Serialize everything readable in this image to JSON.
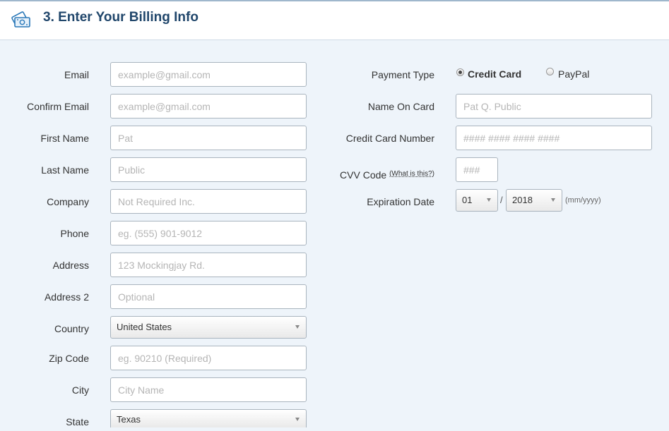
{
  "header": {
    "title": "3. Enter Your Billing Info",
    "icon": "money-icon",
    "accent": "#20466b"
  },
  "left_fields": {
    "email": {
      "label": "Email",
      "placeholder": "example@gmail.com"
    },
    "confirm_email": {
      "label": "Confirm Email",
      "placeholder": "example@gmail.com"
    },
    "first_name": {
      "label": "First Name",
      "placeholder": "Pat"
    },
    "last_name": {
      "label": "Last Name",
      "placeholder": "Public"
    },
    "company": {
      "label": "Company",
      "placeholder": "Not Required Inc."
    },
    "phone": {
      "label": "Phone",
      "placeholder": "eg. (555) 901-9012"
    },
    "address": {
      "label": "Address",
      "placeholder": "123 Mockingjay Rd."
    },
    "address2": {
      "label": "Address 2",
      "placeholder": "Optional"
    },
    "country": {
      "label": "Country",
      "value": "United States"
    },
    "zip": {
      "label": "Zip Code",
      "placeholder": "eg. 90210 (Required)"
    },
    "city": {
      "label": "City",
      "placeholder": "City Name"
    },
    "state": {
      "label": "State",
      "value": "Texas"
    }
  },
  "payment": {
    "type_label": "Payment Type",
    "option_credit": "Credit Card",
    "option_paypal": "PayPal",
    "selected": "Credit Card",
    "name_on_card": {
      "label": "Name On Card",
      "placeholder": "Pat Q. Public"
    },
    "card_number": {
      "label": "Credit Card Number",
      "placeholder": "#### #### #### ####"
    },
    "cvv": {
      "label": "CVV Code",
      "help": "(What is this?)",
      "placeholder": "###"
    },
    "expiration": {
      "label": "Expiration Date",
      "month": "01",
      "separator": "/",
      "year": "2018",
      "format_hint": "(mm/yyyy)"
    }
  }
}
